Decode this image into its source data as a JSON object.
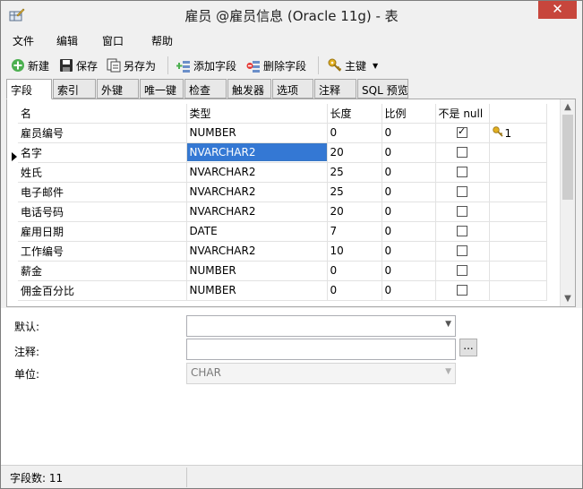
{
  "window": {
    "title": "雇员 @雇员信息 (Oracle 11g) - 表",
    "close_label": "✕"
  },
  "menu": [
    "文件",
    "编辑",
    "窗口",
    "帮助"
  ],
  "toolbar": {
    "new_label": "新建",
    "save_label": "保存",
    "save_as_label": "另存为",
    "add_field_label": "添加字段",
    "delete_field_label": "删除字段",
    "primary_key_label": "主键"
  },
  "tabs": [
    "字段",
    "索引",
    "外键",
    "唯一键",
    "检查",
    "触发器",
    "选项",
    "注释",
    "SQL 预览"
  ],
  "grid": {
    "headers": [
      "名",
      "类型",
      "长度",
      "比例",
      "不是 null",
      ""
    ],
    "rows": [
      {
        "name": "雇员编号",
        "type": "NUMBER",
        "length": "0",
        "scale": "0",
        "not_null": true,
        "key": "1"
      },
      {
        "name": "名字",
        "type": "NVARCHAR2",
        "length": "20",
        "scale": "0",
        "not_null": false,
        "key": ""
      },
      {
        "name": "姓氏",
        "type": "NVARCHAR2",
        "length": "25",
        "scale": "0",
        "not_null": false,
        "key": ""
      },
      {
        "name": "电子邮件",
        "type": "NVARCHAR2",
        "length": "25",
        "scale": "0",
        "not_null": false,
        "key": ""
      },
      {
        "name": "电话号码",
        "type": "NVARCHAR2",
        "length": "20",
        "scale": "0",
        "not_null": false,
        "key": ""
      },
      {
        "name": "雇用日期",
        "type": "DATE",
        "length": "7",
        "scale": "0",
        "not_null": false,
        "key": ""
      },
      {
        "name": "工作编号",
        "type": "NVARCHAR2",
        "length": "10",
        "scale": "0",
        "not_null": false,
        "key": ""
      },
      {
        "name": "薪金",
        "type": "NUMBER",
        "length": "0",
        "scale": "0",
        "not_null": false,
        "key": ""
      },
      {
        "name": "佣金百分比",
        "type": "NUMBER",
        "length": "0",
        "scale": "0",
        "not_null": false,
        "key": ""
      }
    ]
  },
  "properties": {
    "default_label": "默认:",
    "default_value": "",
    "comment_label": "注释:",
    "comment_value": "",
    "comment_button": "...",
    "unit_label": "单位:",
    "unit_value": "CHAR"
  },
  "status": {
    "field_count": "字段数: 11"
  },
  "colors": {
    "selection": "#3478d4",
    "close_button": "#c7463c",
    "key_icon": "#d4a017"
  }
}
